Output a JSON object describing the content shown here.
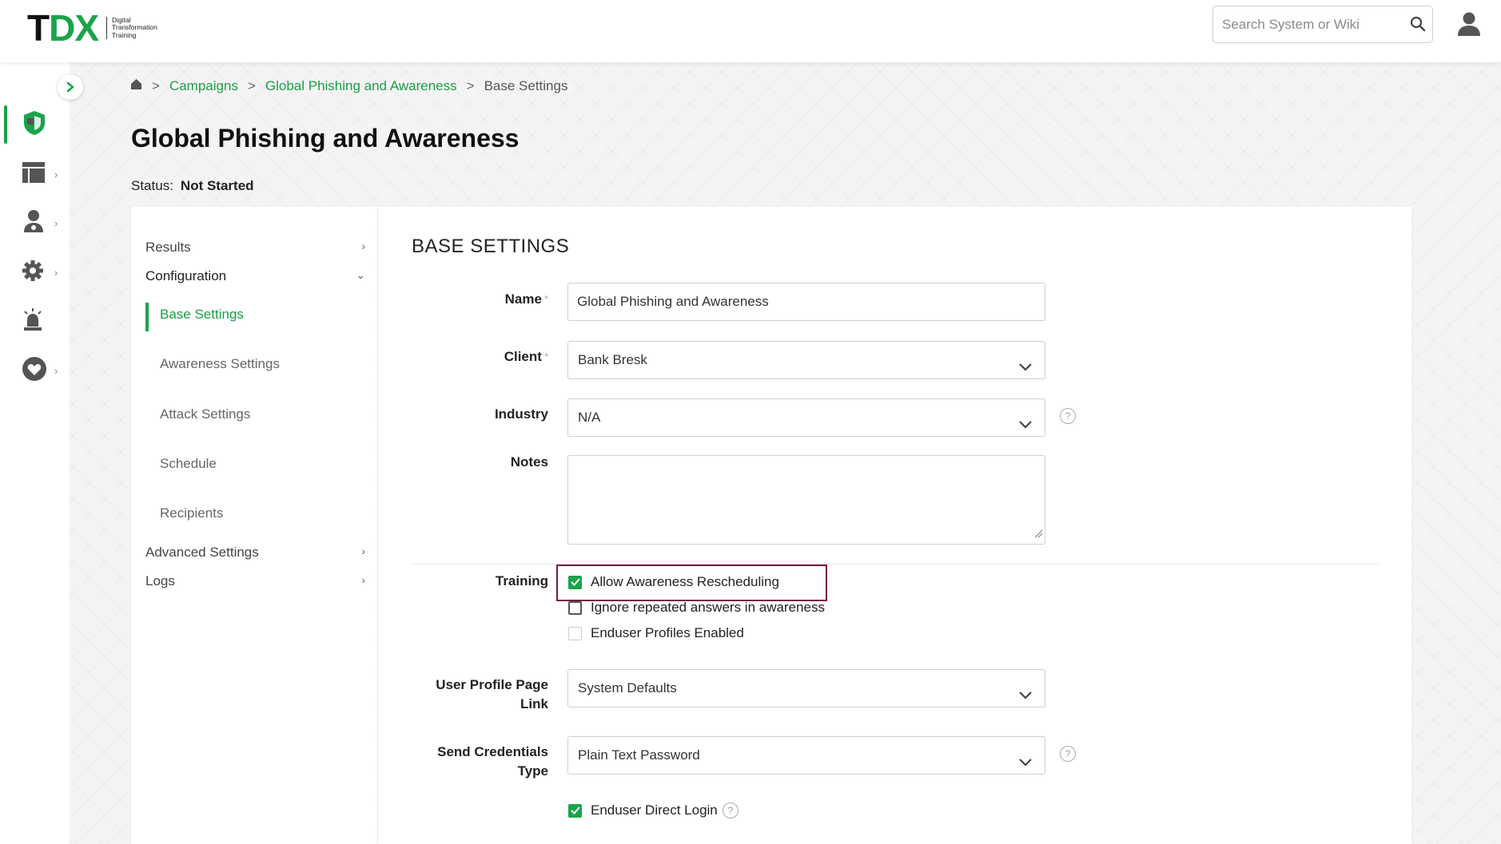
{
  "header": {
    "logo_t": "T",
    "logo_dx": "DX",
    "logo_sub_1": "Digital",
    "logo_sub_2": "Transformation",
    "logo_sub_3": "Training",
    "search_placeholder": "Search System or Wiki"
  },
  "breadcrumb": {
    "sep": ">",
    "campaigns": "Campaigns",
    "campaign": "Global Phishing and Awareness",
    "current": "Base Settings"
  },
  "page": {
    "title": "Global Phishing and Awareness",
    "status_label": "Status:",
    "status_value": "Not Started"
  },
  "nav": {
    "results": "Results",
    "configuration": "Configuration",
    "base_settings": "Base Settings",
    "awareness_settings": "Awareness Settings",
    "attack_settings": "Attack Settings",
    "schedule": "Schedule",
    "recipients": "Recipients",
    "advanced_settings": "Advanced Settings",
    "logs": "Logs"
  },
  "form": {
    "section_title": "BASE SETTINGS",
    "required_mark": "*",
    "help_mark": "?",
    "name_label": "Name",
    "name_value": "Global Phishing and Awareness",
    "client_label": "Client",
    "client_value": "Bank Bresk",
    "industry_label": "Industry",
    "industry_value": "N/A",
    "notes_label": "Notes",
    "training_label": "Training",
    "allow_rescheduling": "Allow Awareness Rescheduling",
    "ignore_repeated": "Ignore repeated answers in awareness",
    "enduser_profiles": "Enduser Profiles Enabled",
    "profile_link_label_1": "User Profile Page",
    "profile_link_label_2": "Link",
    "profile_link_value": "System Defaults",
    "send_credentials_label_1": "Send Credentials",
    "send_credentials_label_2": "Type",
    "send_credentials_value": "Plain Text Password",
    "enduser_direct_login": "Enduser Direct Login"
  },
  "checkbox_states": {
    "allow_rescheduling": true,
    "ignore_repeated": false,
    "enduser_profiles": false,
    "enduser_direct_login": true
  },
  "colors": {
    "accent": "#1aa34a",
    "highlight_border": "#7b1a3c"
  }
}
